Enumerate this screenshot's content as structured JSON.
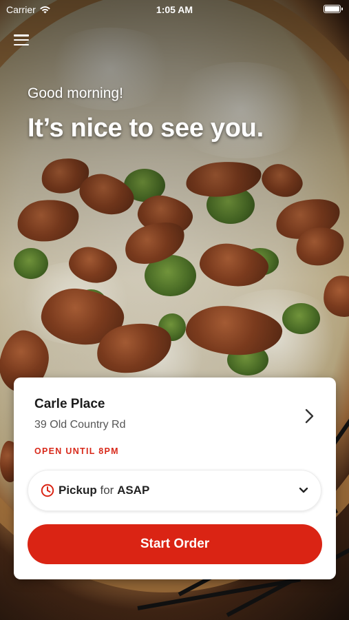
{
  "status_bar": {
    "carrier": "Carrier",
    "time": "1:05 AM",
    "wifi_icon": "wifi-icon",
    "battery_icon": "battery-icon"
  },
  "header": {
    "menu_icon": "hamburger-menu-icon",
    "greeting": "Good morning!",
    "headline": "It’s nice to see you."
  },
  "store": {
    "name": "Carle Place",
    "address": "39 Old Country Rd",
    "hours": "OPEN UNTIL 8PM",
    "chevron_icon": "chevron-right-icon"
  },
  "order_mode": {
    "icon": "clock-icon",
    "mode": "Pickup",
    "connector": "for",
    "time": "ASAP",
    "chevron_icon": "chevron-down-icon"
  },
  "actions": {
    "start_order": "Start Order"
  },
  "colors": {
    "accent": "#da2414",
    "hours_text": "#d8291a",
    "card_bg": "#ffffff"
  }
}
